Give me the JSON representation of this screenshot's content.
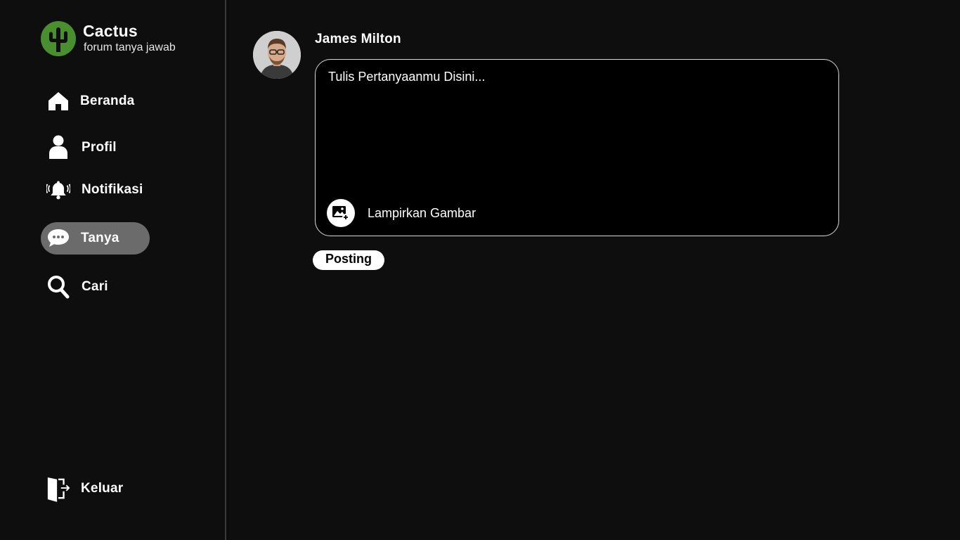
{
  "brand": {
    "name": "Cactus",
    "tagline": "forum tanya jawab",
    "logo_color": "#4a8f2f"
  },
  "sidebar": {
    "items": [
      {
        "label": "Beranda",
        "icon": "home-icon",
        "active": false
      },
      {
        "label": "Profil",
        "icon": "user-icon",
        "active": false
      },
      {
        "label": "Notifikasi",
        "icon": "bell-icon",
        "active": false
      },
      {
        "label": "Tanya",
        "icon": "chat-bubble-icon",
        "active": true
      },
      {
        "label": "Cari",
        "icon": "search-icon",
        "active": false
      }
    ],
    "logout": {
      "label": "Keluar",
      "icon": "logout-door-icon"
    }
  },
  "user": {
    "name": "James Milton"
  },
  "composer": {
    "placeholder": "Tulis Pertanyaanmu Disini...",
    "attach_label": "Lampirkan Gambar",
    "attach_icon": "add-image-icon"
  },
  "actions": {
    "post_label": "Posting"
  },
  "colors": {
    "background": "#0e0e0e",
    "active_nav": "#6b6b6b",
    "accent_green": "#4a8f2f"
  }
}
